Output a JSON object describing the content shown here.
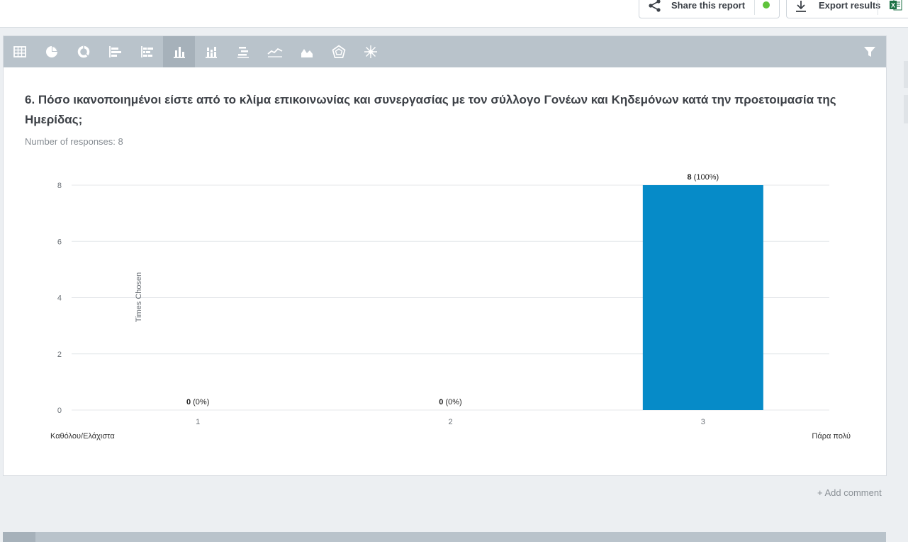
{
  "header": {
    "share_label": "Share this report",
    "export_label": "Export results",
    "status_color": "#5fc33b"
  },
  "toolbar": {
    "icons": [
      "table-icon",
      "pie-chart-icon",
      "donut-chart-icon",
      "horizontal-bar-icon",
      "stacked-horizontal-bar-icon",
      "vertical-bar-icon",
      "stacked-vertical-bar-icon",
      "centered-bar-icon",
      "line-chart-icon",
      "area-chart-icon",
      "radar-chart-icon",
      "star-chart-icon"
    ],
    "active": "vertical-bar-icon",
    "filter_icon": "filter-icon"
  },
  "question": {
    "title": "6. Πόσο ικανοποιημένοι είστε από το κλίμα επικοινωνίας και συνεργασίας με τον σύλλογο Γονέων και Κηδεμόνων κατά την προετοιμασία της Ημερίδας;",
    "responses": "Number of responses: 8"
  },
  "chart_data": {
    "type": "bar",
    "categories": [
      "1",
      "2",
      "3"
    ],
    "values": [
      0,
      0,
      8
    ],
    "value_labels": [
      {
        "count": "0",
        "pct": "(0%)"
      },
      {
        "count": "0",
        "pct": "(0%)"
      },
      {
        "count": "8",
        "pct": "(100%)"
      }
    ],
    "ylabel": "Times Chosen",
    "yticks": [
      "0",
      "2",
      "4",
      "6",
      "8"
    ],
    "ylim": [
      0,
      8
    ],
    "scale_min_label": "Καθόλου/Ελάχιστα",
    "scale_max_label": "Πάρα πολύ",
    "bar_color": "#068bc8",
    "grid": true
  },
  "footer": {
    "add_comment": "+ Add comment"
  }
}
